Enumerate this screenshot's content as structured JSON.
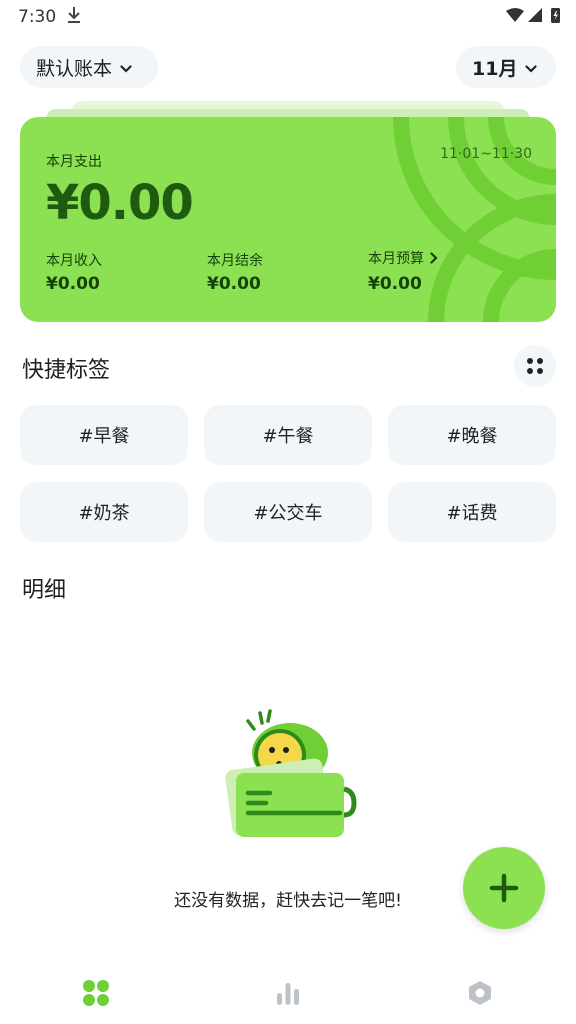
{
  "status_bar": {
    "time": "7:30"
  },
  "header": {
    "book_label": "默认账本",
    "month_label": "11月"
  },
  "summary_card": {
    "expense_label": "本月支出",
    "expense_value": "¥0.00",
    "date_range": "11·01~11·30",
    "income_label": "本月收入",
    "income_value": "¥0.00",
    "balance_label": "本月结余",
    "balance_value": "¥0.00",
    "budget_label": "本月预算",
    "budget_value": "¥0.00"
  },
  "quick_tags": {
    "title": "快捷标签",
    "items": [
      "#早餐",
      "#午餐",
      "#晚餐",
      "#奶茶",
      "#公交车",
      "#话费"
    ]
  },
  "details": {
    "title": "明细",
    "empty_message": "还没有数据，赶快去记一笔吧!"
  },
  "bottom_nav": {
    "items": [
      {
        "icon": "grid-dots-icon",
        "active": true
      },
      {
        "icon": "bar-chart-icon",
        "active": false
      },
      {
        "icon": "hexagon-settings-icon",
        "active": false
      }
    ]
  },
  "colors": {
    "accent": "#8be152",
    "accent_dark": "#2e8a1a",
    "surface": "#f2f6f9"
  }
}
